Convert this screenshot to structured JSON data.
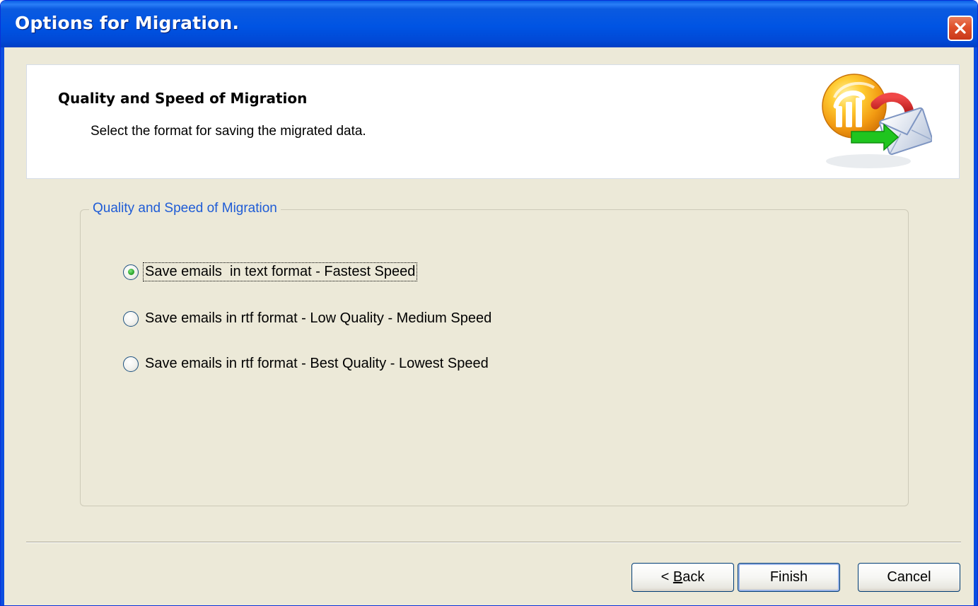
{
  "window": {
    "title": "Options for Migration."
  },
  "header": {
    "title": "Quality and Speed of Migration",
    "subtitle": "Select the format for saving the migrated data.",
    "logo_icon": "lotus-to-mail-migration-icon"
  },
  "group": {
    "legend": "Quality and Speed of Migration",
    "selected_index": 0,
    "options": [
      {
        "label": "Save emails  in text format - Fastest Speed",
        "checked": true
      },
      {
        "label": "Save emails in rtf format - Low Quality - Medium Speed",
        "checked": false
      },
      {
        "label": "Save emails in rtf format - Best Quality - Lowest Speed",
        "checked": false
      }
    ]
  },
  "buttons": {
    "back_prefix": "< ",
    "back_accel": "B",
    "back_rest": "ack",
    "finish": "Finish",
    "cancel": "Cancel"
  },
  "colors": {
    "titlebar": "#0054e3",
    "dialog_bg": "#ece9d8",
    "legend_text": "#1f5cd6",
    "close_button": "#e0502a",
    "radio_dot": "#2ea52e"
  }
}
